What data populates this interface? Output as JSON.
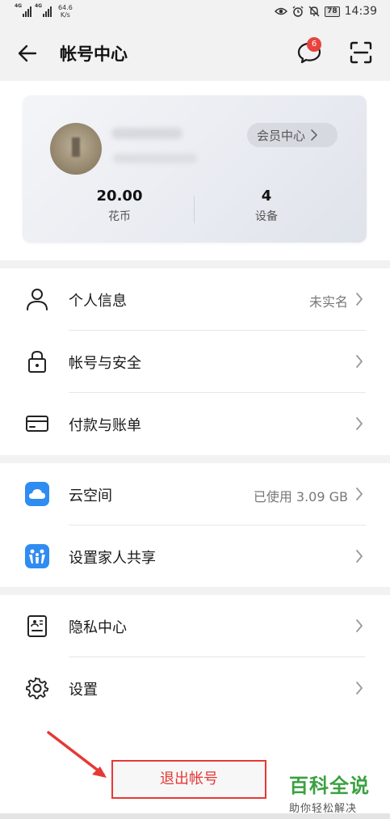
{
  "status_bar": {
    "signal_tag_1": "4G",
    "signal_tag_2": "4G",
    "net_speed": "64.6",
    "net_speed_unit": "K/s",
    "battery": "78",
    "time": "14:39"
  },
  "header": {
    "title": "帐号中心",
    "message_badge": "6"
  },
  "account": {
    "vip_label": "会员中心",
    "coins_value": "20.00",
    "coins_label": "花币",
    "devices_value": "4",
    "devices_label": "设备"
  },
  "menu": {
    "personal_info": {
      "label": "个人信息",
      "value": "未实名"
    },
    "account_security": {
      "label": "帐号与安全"
    },
    "payment": {
      "label": "付款与账单"
    },
    "cloud": {
      "label": "云空间",
      "value": "已使用 3.09 GB"
    },
    "family_share": {
      "label": "设置家人共享"
    },
    "privacy": {
      "label": "隐私中心"
    },
    "settings": {
      "label": "设置"
    }
  },
  "logout_label": "退出帐号",
  "watermark": {
    "title": "百科全说",
    "subtitle": "助你轻松解决"
  },
  "colors": {
    "accent_red": "#e53935",
    "badge_red": "#e8433d",
    "cloud_blue": "#2f8cf0",
    "watermark_green": "#3aa141"
  },
  "icons": [
    "back-arrow-icon",
    "message-icon",
    "scan-icon",
    "person-icon",
    "lock-icon",
    "card-icon",
    "cloud-icon",
    "family-icon",
    "privacy-icon",
    "gear-icon",
    "chevron-right-icon"
  ]
}
